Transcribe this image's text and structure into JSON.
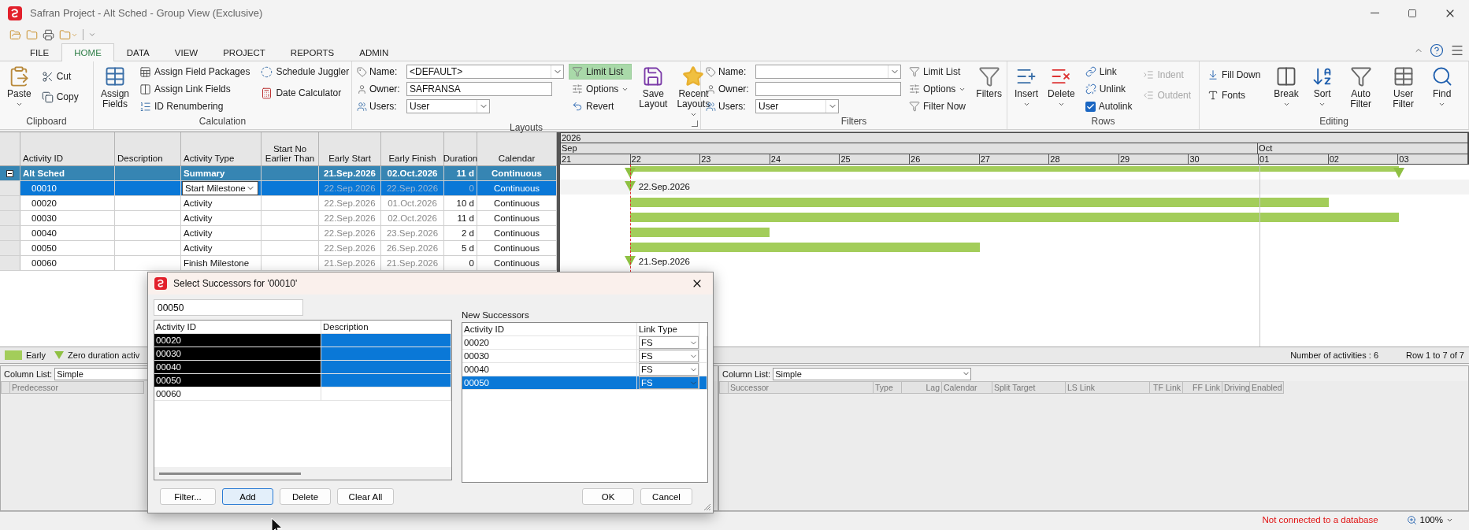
{
  "window": {
    "title": "Safran Project - Alt Sched - Group View (Exclusive)"
  },
  "menu_tabs": [
    {
      "label": "FILE",
      "selected": false
    },
    {
      "label": "HOME",
      "selected": true
    },
    {
      "label": "DATA",
      "selected": false
    },
    {
      "label": "VIEW",
      "selected": false
    },
    {
      "label": "PROJECT",
      "selected": false
    },
    {
      "label": "REPORTS",
      "selected": false
    },
    {
      "label": "ADMIN",
      "selected": false
    }
  ],
  "ribbon": {
    "clipboard": {
      "title": "Clipboard",
      "paste": "Paste",
      "cut": "Cut",
      "copy": "Copy"
    },
    "calculation": {
      "title": "Calculation",
      "assign_fields": "Assign Fields",
      "assign_field_packages": "Assign Field Packages",
      "assign_link_fields": "Assign Link Fields",
      "id_renumbering": "ID Renumbering",
      "schedule_juggler": "Schedule Juggler",
      "date_calculator": "Date Calculator"
    },
    "layouts": {
      "title": "Layouts",
      "name_label": "Name:",
      "name_value": "<DEFAULT>",
      "owner_label": "Owner:",
      "owner_value": "SAFRANSA",
      "users_label": "Users:",
      "users_value": "User",
      "limit_list": {
        "label": "Limit List",
        "on": true
      },
      "options": "Options",
      "revert": "Revert",
      "save_layout": "Save Layout",
      "recent_layouts": "Recent Layouts"
    },
    "filters": {
      "title": "Filters",
      "name_label": "Name:",
      "owner_label": "Owner:",
      "users_label": "Users:",
      "users_value": "User",
      "limit_list": {
        "label": "Limit List",
        "on": false
      },
      "options": "Options",
      "filter_now": "Filter Now",
      "filters": "Filters"
    },
    "rows": {
      "title": "Rows",
      "insert": "Insert",
      "delete": "Delete",
      "link": "Link",
      "unlink": "Unlink",
      "autolink": {
        "label": "Autolink",
        "checked": true
      },
      "indent": {
        "label": "Indent",
        "disabled": true
      },
      "outdent": {
        "label": "Outdent",
        "disabled": true
      }
    },
    "editing": {
      "title": "Editing",
      "fill_down": "Fill Down",
      "fonts": "Fonts",
      "break": "Break",
      "sort": "Sort",
      "auto_filter": "Auto Filter",
      "user_filter": "User Filter",
      "find": "Find"
    }
  },
  "activity_table": {
    "columns": [
      "Activity ID",
      "Description",
      "Activity Type",
      "Start No Earlier Than",
      "Early Start",
      "Early Finish",
      "Duration",
      "Calendar"
    ],
    "rows": [
      {
        "kind": "summary",
        "expanded": true,
        "selected": false,
        "activity_id": "Alt Sched",
        "activity_type": "Summary",
        "early_start": "21.Sep.2026",
        "early_finish": "02.Oct.2026",
        "duration": "11 d",
        "calendar": "Continuous"
      },
      {
        "kind": "activity",
        "selected": true,
        "activity_id": "00010",
        "activity_type": "Start Milestone",
        "early_start": "22.Sep.2026",
        "early_finish": "22.Sep.2026",
        "duration": "0",
        "calendar": "Continuous"
      },
      {
        "kind": "activity",
        "selected": false,
        "activity_id": "00020",
        "activity_type": "Activity",
        "early_start": "22.Sep.2026",
        "early_finish": "01.Oct.2026",
        "duration": "10 d",
        "calendar": "Continuous"
      },
      {
        "kind": "activity",
        "selected": false,
        "activity_id": "00030",
        "activity_type": "Activity",
        "early_start": "22.Sep.2026",
        "early_finish": "02.Oct.2026",
        "duration": "11 d",
        "calendar": "Continuous"
      },
      {
        "kind": "activity",
        "selected": false,
        "activity_id": "00040",
        "activity_type": "Activity",
        "early_start": "22.Sep.2026",
        "early_finish": "23.Sep.2026",
        "duration": "2 d",
        "calendar": "Continuous"
      },
      {
        "kind": "activity",
        "selected": false,
        "activity_id": "00050",
        "activity_type": "Activity",
        "early_start": "22.Sep.2026",
        "early_finish": "26.Sep.2026",
        "duration": "5 d",
        "calendar": "Continuous"
      },
      {
        "kind": "activity",
        "selected": false,
        "activity_id": "00060",
        "activity_type": "Finish Milestone",
        "early_start": "21.Sep.2026",
        "early_finish": "21.Sep.2026",
        "duration": "0",
        "calendar": "Continuous"
      }
    ]
  },
  "gantt": {
    "year": "2026",
    "months": [
      "Sep",
      "Oct"
    ],
    "days": [
      "21",
      "22",
      "23",
      "24",
      "25",
      "26",
      "27",
      "28",
      "29",
      "30",
      "01",
      "02",
      "03"
    ],
    "bars": [
      {
        "kind": "summary"
      },
      {
        "kind": "milestone",
        "label": "22.Sep.2026"
      },
      {
        "kind": "bar"
      },
      {
        "kind": "bar"
      },
      {
        "kind": "bar"
      },
      {
        "kind": "bar"
      },
      {
        "kind": "milestone",
        "label": "21.Sep.2026"
      }
    ]
  },
  "legend": {
    "early": "Early",
    "zero_duration": "Zero duration activ",
    "count": "Number of activities : 6",
    "rows": "Row 1 to 7 of 7"
  },
  "predecessor_panel": {
    "column_list_label": "Column List:",
    "column_list_value": "Simple",
    "columns": [
      "Predecessor"
    ]
  },
  "successor_panel": {
    "column_list_label": "Column List:",
    "column_list_value": "Simple",
    "columns": [
      "Successor",
      "Type",
      "Lag",
      "Calendar",
      "Split Target",
      "LS Link",
      "TF Link",
      "FF Link",
      "Driving",
      "Enabled"
    ]
  },
  "status_bar": {
    "connection": "Not connected to a database",
    "zoom": "100%"
  },
  "dialog": {
    "title": "Select Successors for '00010'",
    "search_value": "00050",
    "list_columns": [
      "Activity ID",
      "Description"
    ],
    "list_rows": [
      {
        "activity_id": "00020",
        "selected": true
      },
      {
        "activity_id": "00030",
        "selected": true
      },
      {
        "activity_id": "00040",
        "selected": true
      },
      {
        "activity_id": "00050",
        "selected": true
      },
      {
        "activity_id": "00060",
        "selected": false
      }
    ],
    "new_successors_label": "New Successors",
    "successor_columns": [
      "Activity ID",
      "Link Type"
    ],
    "successors": [
      {
        "activity_id": "00020",
        "link_type": "FS",
        "selected": false
      },
      {
        "activity_id": "00030",
        "link_type": "FS",
        "selected": false
      },
      {
        "activity_id": "00040",
        "link_type": "FS",
        "selected": false
      },
      {
        "activity_id": "00050",
        "link_type": "FS",
        "selected": true
      }
    ],
    "buttons": {
      "filter": "Filter...",
      "add": "Add",
      "delete": "Delete",
      "clear_all": "Clear All",
      "ok": "OK",
      "cancel": "Cancel"
    }
  }
}
